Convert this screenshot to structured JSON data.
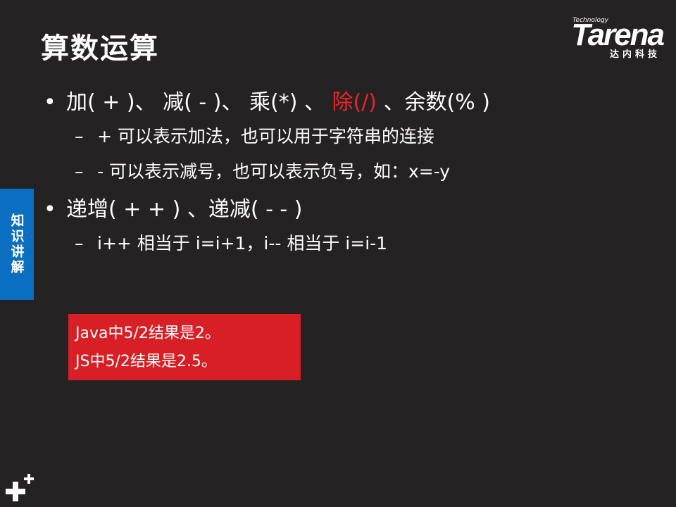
{
  "slide": {
    "title": "算数运算",
    "logo": {
      "technology": "Technology",
      "brand": "Tarena",
      "subtitle": "达内科技"
    },
    "side_tab": "知识讲解",
    "bullets": {
      "b1_pre": "加( + )、 减( - )、 乘(*) 、",
      "b1_red": "除(/)",
      "b1_post": "、余数(% )",
      "b1_s1": "+ 可以表示加法，也可以用于字符串的连接",
      "b1_s2": "-  可以表示减号，也可以表示负号，如：x=-y",
      "b2": "递增( + + ) 、递减( - - )",
      "b2_s1": "i++ 相当于 i=i+1，i-- 相当于 i=i-1"
    },
    "note": {
      "line1": "Java中5/2结果是2。",
      "line2": "JS中5/2结果是2.5。"
    },
    "colors": {
      "background": "#252223",
      "accent_red": "#e8252a",
      "side_tab": "#0a6fc0",
      "note_bg": "#d81f26"
    }
  }
}
